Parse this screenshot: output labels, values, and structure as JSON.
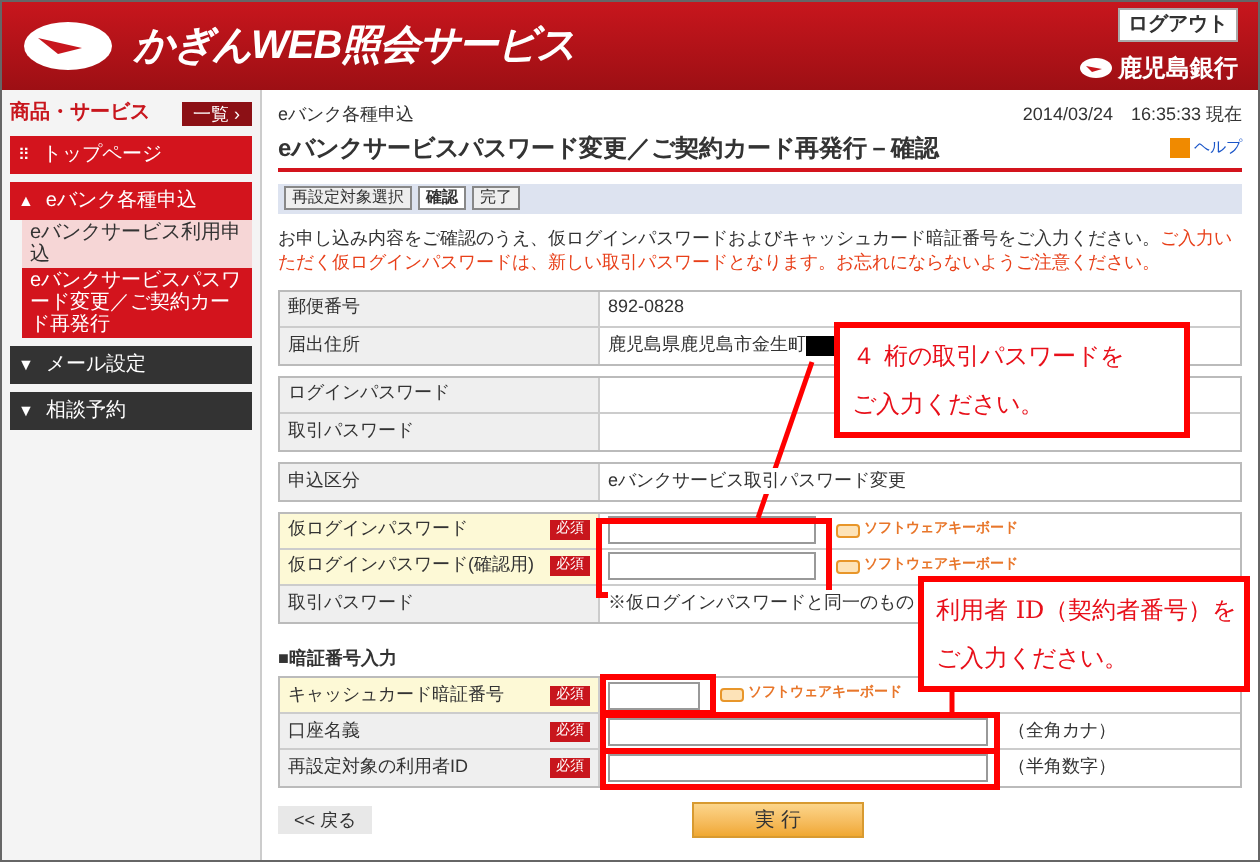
{
  "header": {
    "title": "かぎんWEB照会サービス",
    "logout": "ログアウト",
    "bank": "鹿児島銀行"
  },
  "sidebar": {
    "heading": "商品・サービス",
    "list_button": "一覧 ›",
    "items": [
      {
        "label": "トップページ",
        "kind": "link",
        "icon": "⠿"
      },
      {
        "label": "eバンク各種申込",
        "kind": "link",
        "icon": "▲",
        "children": [
          {
            "label": "eバンクサービス利用申込",
            "selected": false
          },
          {
            "label": "eバンクサービスパスワード変更／ご契約カード再発行",
            "selected": true
          }
        ]
      },
      {
        "label": "メール設定",
        "kind": "menu",
        "icon": "▼"
      },
      {
        "label": "相談予約",
        "kind": "menu",
        "icon": "▼"
      }
    ]
  },
  "page": {
    "category": "eバンク各種申込",
    "timestamp": "2014/03/24　16:35:33 現在",
    "title": "eバンクサービスパスワード変更／ご契約カード再発行－確認",
    "help": "ヘルプ",
    "steps": [
      {
        "label": "再設定対象選択",
        "selected": false
      },
      {
        "label": "確認",
        "selected": true
      },
      {
        "label": "完了",
        "selected": false
      }
    ],
    "intro": "お申し込み内容をご確認のうえ、仮ログインパスワードおよびキャッシュカード暗証番号をご入力ください。",
    "warning": "ご入力いただく仮ログインパスワードは、新しい取引パスワードとなります。お忘れにならないようご注意ください。"
  },
  "groups": [
    {
      "rows": [
        {
          "label": "郵便番号",
          "value": "892-0828"
        },
        {
          "label": "届出住所",
          "value": "鹿児島県鹿児島市金生町",
          "redacted": true
        }
      ]
    },
    {
      "rows": [
        {
          "label": "ログインパスワード"
        },
        {
          "label": "取引パスワード"
        }
      ]
    },
    {
      "rows": [
        {
          "label": "申込区分",
          "value": "eバンクサービス取引パスワード変更"
        }
      ]
    },
    {
      "rows": [
        {
          "label": "仮ログインパスワード",
          "required": "必須",
          "shaded": true,
          "kind": "password",
          "keyboard": "ソフトウェアキーボード"
        },
        {
          "label": "仮ログインパスワード(確認用)",
          "required": "必須",
          "shaded": true,
          "kind": "password",
          "keyboard": "ソフトウェアキーボード"
        },
        {
          "label": "取引パスワード",
          "value": "※仮ログインパスワードと同一のもの"
        }
      ]
    },
    {
      "heading": "■暗証番号入力",
      "rows": [
        {
          "label": "キャッシュカード暗証番号",
          "required": "必須",
          "shaded": true,
          "kind": "pin",
          "keyboard": "ソフトウェアキーボード"
        },
        {
          "label": "口座名義",
          "required": "必須",
          "shaded": false,
          "kind": "text",
          "suffix": "（全角カナ）"
        },
        {
          "label": "再設定対象の利用者ID",
          "required": "必須",
          "shaded": false,
          "kind": "text",
          "suffix": "（半角数字）"
        }
      ]
    }
  ],
  "buttons": {
    "back": "<< 戻る",
    "submit": "実 行"
  },
  "callouts": [
    {
      "lines": [
        "４ 桁の取引パスワードを",
        "ご入力ください。"
      ]
    },
    {
      "lines": [
        "利用者 ID（契約者番号）を",
        "ご入力ください。"
      ]
    }
  ]
}
